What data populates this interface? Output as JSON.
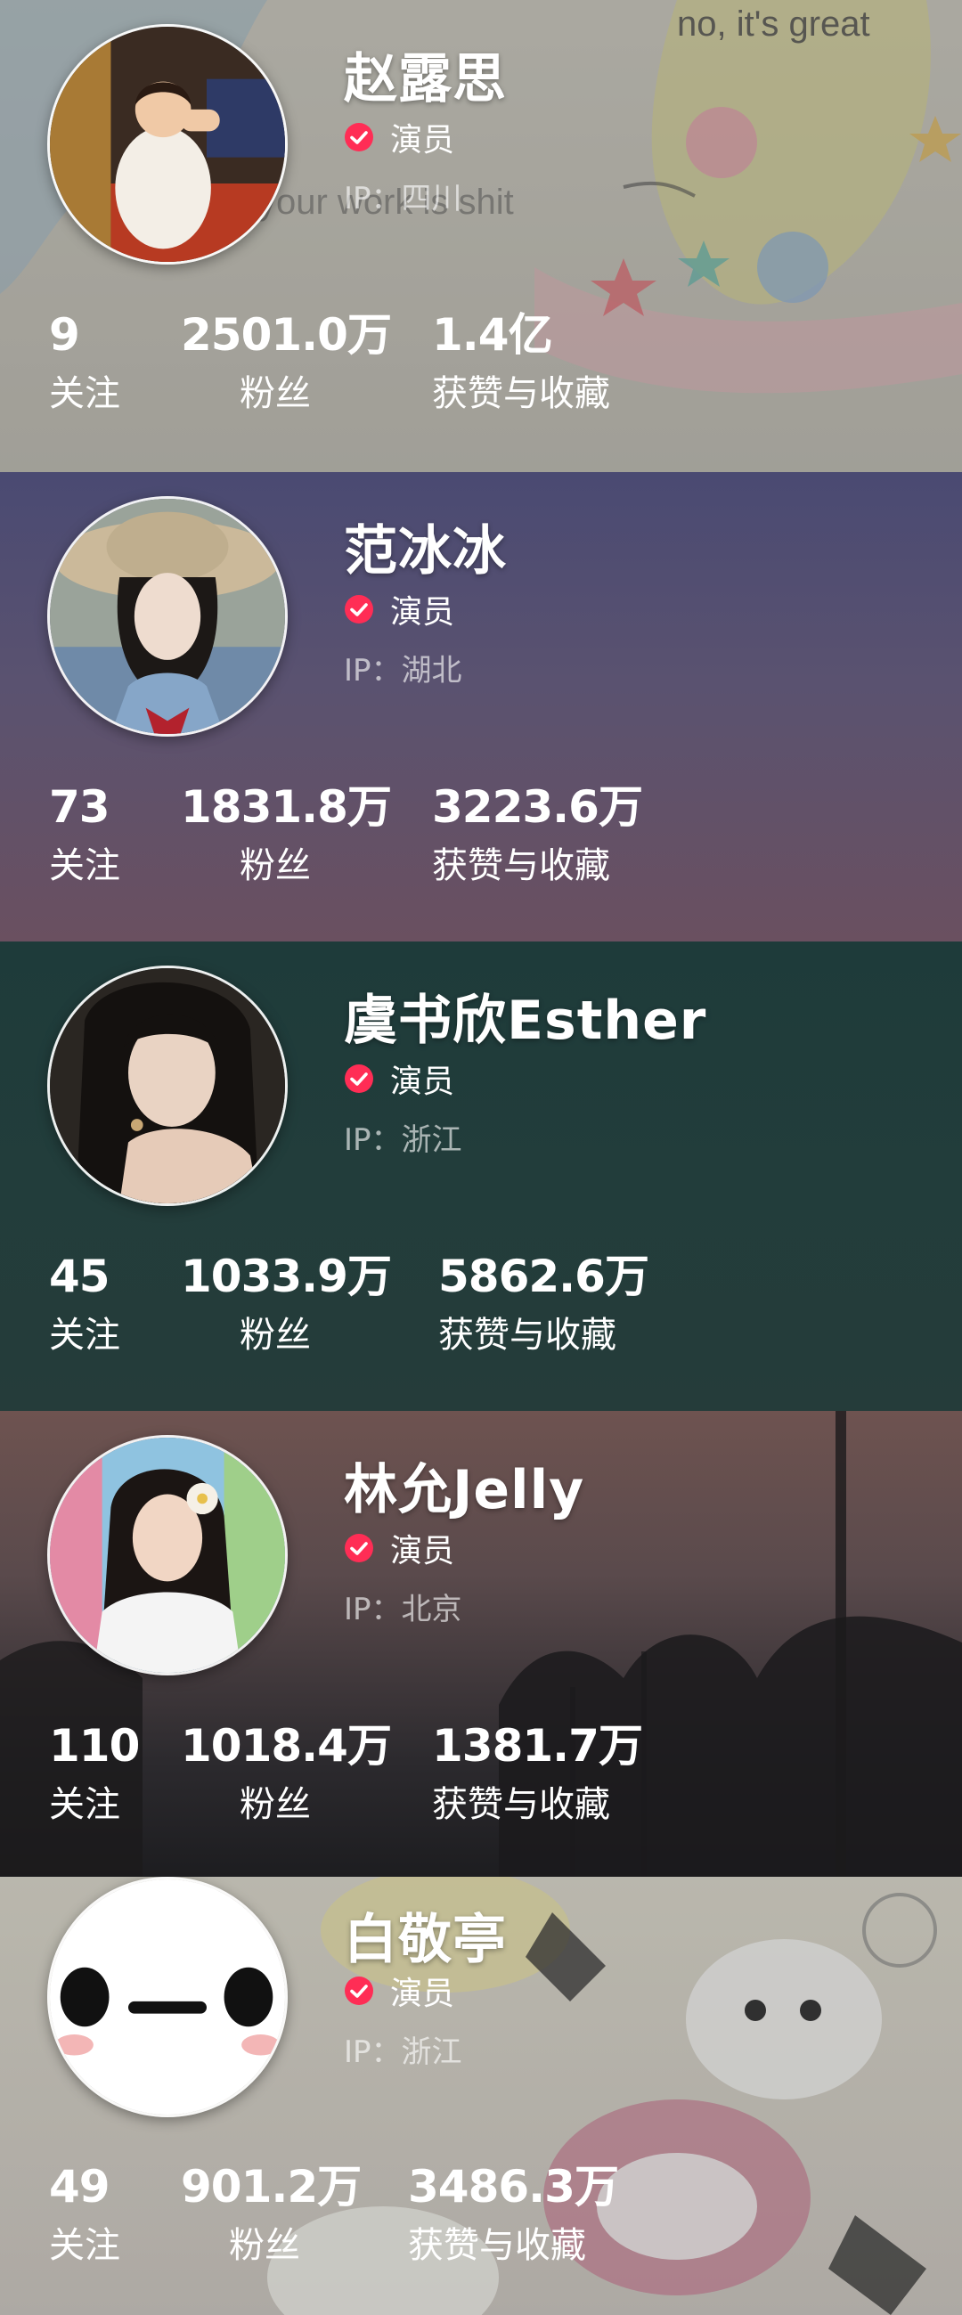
{
  "accent_color": "#ff2d55",
  "profiles": [
    {
      "name": "赵露思",
      "verified_icon": "verified-check-icon",
      "role": "演员",
      "ip": "IP：四川",
      "following": "9",
      "following_label": "关注",
      "fans": "2501.0万",
      "fans_label": "粉丝",
      "likes": "1.4亿",
      "likes_label": "获赞与收藏",
      "background_texts": [
        "no, it's great",
        "your work is shit"
      ]
    },
    {
      "name": "范冰冰",
      "verified_icon": "verified-check-icon",
      "role": "演员",
      "ip": "IP：湖北",
      "following": "73",
      "following_label": "关注",
      "fans": "1831.8万",
      "fans_label": "粉丝",
      "likes": "3223.6万",
      "likes_label": "获赞与收藏"
    },
    {
      "name": "虞书欣Esther",
      "verified_icon": "verified-check-icon",
      "role": "演员",
      "ip": "IP：浙江",
      "following": "45",
      "following_label": "关注",
      "fans": "1033.9万",
      "fans_label": "粉丝",
      "likes": "5862.6万",
      "likes_label": "获赞与收藏"
    },
    {
      "name": "林允Jelly",
      "verified_icon": "verified-check-icon",
      "role": "演员",
      "ip": "IP：北京",
      "following": "110",
      "following_label": "关注",
      "fans": "1018.4万",
      "fans_label": "粉丝",
      "likes": "1381.7万",
      "likes_label": "获赞与收藏"
    },
    {
      "name": "白敬亭",
      "verified_icon": "verified-check-icon",
      "role": "演员",
      "ip": "IP：浙江",
      "following": "49",
      "following_label": "关注",
      "fans": "901.2万",
      "fans_label": "粉丝",
      "likes": "3486.3万",
      "likes_label": "获赞与收藏"
    }
  ]
}
